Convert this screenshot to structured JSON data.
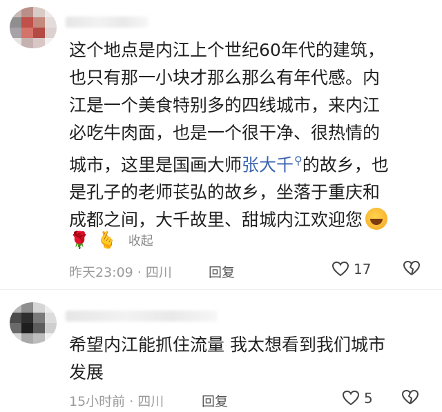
{
  "comments": [
    {
      "text_lines": [
        "这个地点是内江上个世纪60年代的建筑，",
        "也只有那一小块才那么那么有年代感。内",
        "江是一个美食特别多的四线城市，来内江",
        "必吃牛肉面，也是一个很干净、很热情的"
      ],
      "line5_before": "城市，这里是国画大师",
      "line5_link": "张大千",
      "line5_after": "的故乡，也",
      "line6": "是孔子的老师苌弘的故乡，坐落于重庆和",
      "line7": "成都之间，大千故里、甜城内江欢迎您",
      "collapse_label": "收起",
      "time_location": "昨天23:09 · 四川",
      "reply_label": "回复",
      "like_count": "17",
      "icons": [
        "search-icon",
        "laughing-emoji-icon",
        "rose-icon",
        "finger-heart-icon",
        "like-heart-icon",
        "dislike-broken-heart-icon"
      ]
    },
    {
      "text_lines": [
        "希望内江能抓住流量 我太想看到我们城市",
        "发展"
      ],
      "time_location": "15小时前 · 四川",
      "reply_label": "回复",
      "like_count": "5",
      "icons": [
        "like-heart-icon",
        "dislike-broken-heart-icon"
      ]
    }
  ],
  "colors": {
    "link": "#3a64b0",
    "meta_text": "#9a9a9a",
    "body_text": "#1f1f1f"
  }
}
